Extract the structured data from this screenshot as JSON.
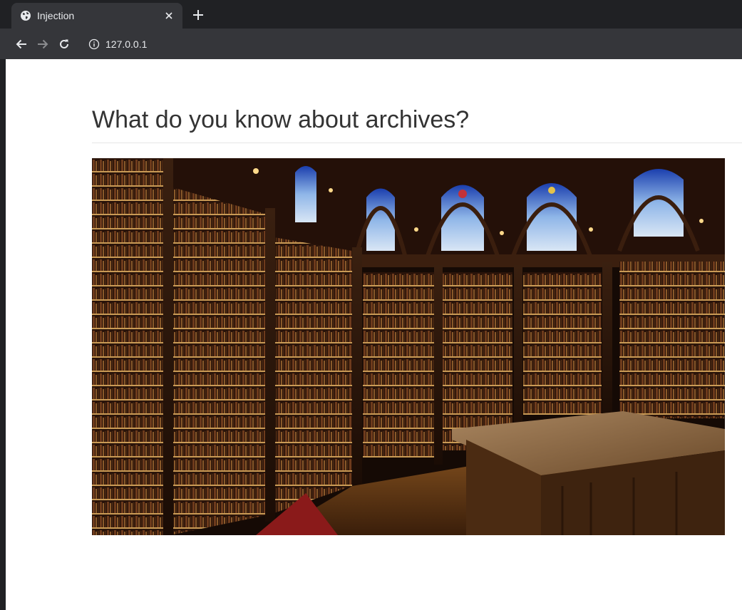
{
  "browser": {
    "tab": {
      "title": "Injection",
      "favicon": "globe-icon",
      "close": "close-icon"
    },
    "new_tab": "plus-icon",
    "toolbar": {
      "back": "arrow-left-icon",
      "forward": "arrow-right-icon",
      "reload": "reload-icon",
      "site_info": "info-icon",
      "url": "127.0.0.1"
    }
  },
  "page": {
    "heading": "What do you know about archives?",
    "image": {
      "subject": "library-interior-photo"
    }
  },
  "colors": {
    "chrome_dark": "#202124",
    "chrome_toolbar": "#35363a",
    "chrome_text": "#e8eaed",
    "page_bg": "#ffffff",
    "heading_text": "#333333"
  }
}
